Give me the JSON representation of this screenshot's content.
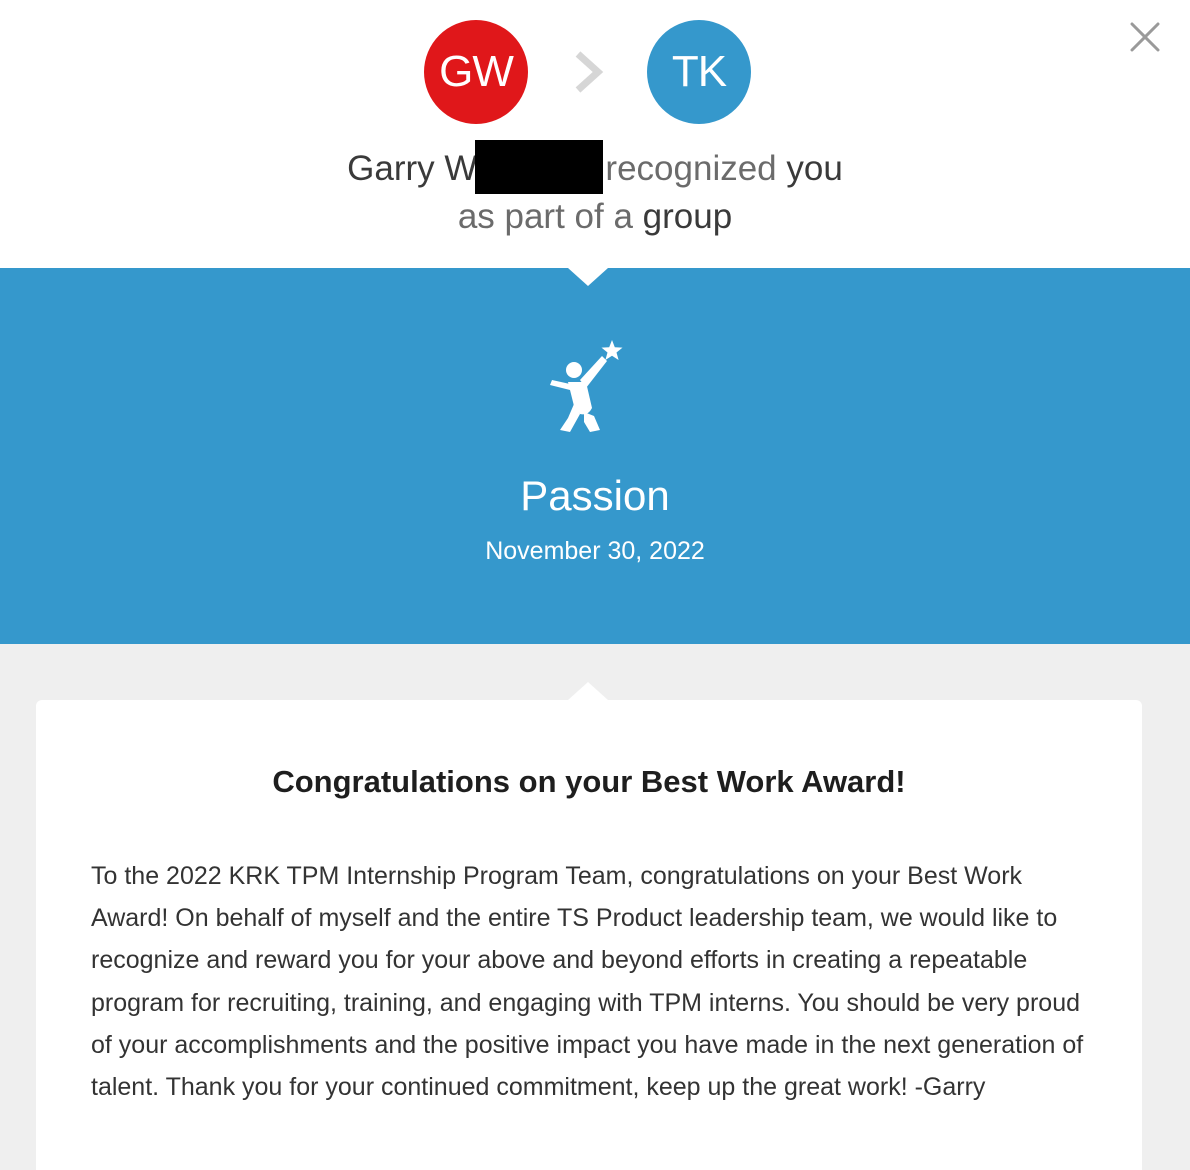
{
  "header": {
    "sender_initials": "GW",
    "sender_avatar_color": "#e0171a",
    "receiver_initials": "TK",
    "receiver_avatar_color": "#3598cc",
    "sender_name_visible": "Garry W",
    "recognized_text": "recognized",
    "you_text": "you",
    "as_part_text": "as part of a",
    "group_text": "group",
    "close_icon": "close-icon",
    "arrow_icon": "chevron-right-icon"
  },
  "award": {
    "band_color": "#3598cc",
    "icon": "person-reaching-star-icon",
    "value_name": "Passion",
    "date": "November 30, 2022"
  },
  "message": {
    "title": "Congratulations on your Best Work Award!",
    "body": "To the 2022 KRK TPM Internship Program Team, congratulations on your Best Work Award! On behalf of myself and the entire TS Product leadership team, we would like to recognize and reward you for your above and beyond efforts in creating a repeatable program for recruiting, training, and engaging with TPM interns. You should be very proud of your accomplishments and the positive impact you have made in the next generation of talent. Thank you for your continued commitment, keep up the great work! -Garry"
  }
}
